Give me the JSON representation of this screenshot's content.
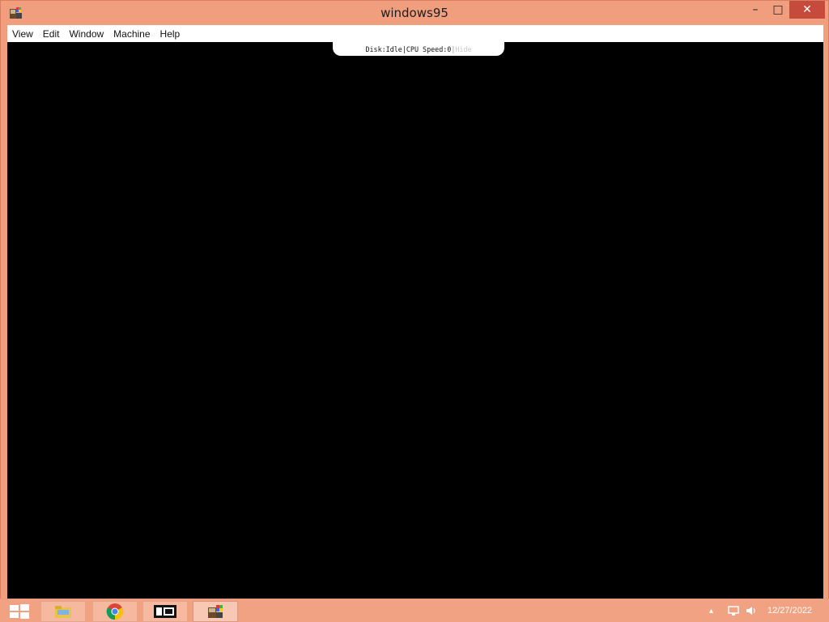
{
  "window": {
    "title": "windows95",
    "controls": {
      "minimize": "–",
      "maximize": "□",
      "close": "✕"
    }
  },
  "menubar": {
    "items": [
      "View",
      "Edit",
      "Window",
      "Machine",
      "Help"
    ]
  },
  "status": {
    "disk_label": "Disk:",
    "disk_value": "Idle",
    "cpu_label": "CPU Speed:",
    "cpu_value": "0",
    "separator": "|",
    "hide_label": "Hide"
  },
  "taskbar": {
    "apps": [
      {
        "icon": "file-explorer-icon"
      },
      {
        "icon": "chrome-icon"
      },
      {
        "icon": "media-player-icon"
      },
      {
        "icon": "windows95-app-icon",
        "active": true
      }
    ],
    "tray": {
      "up_arrow": "▴",
      "network_icon": "network-icon",
      "volume_icon": "volume-icon"
    },
    "clock": "12/27/2022"
  },
  "colors": {
    "frame": "#f19e7f",
    "close_button": "#c74b3c",
    "screen": "#000000",
    "menubar": "#ffffff"
  }
}
